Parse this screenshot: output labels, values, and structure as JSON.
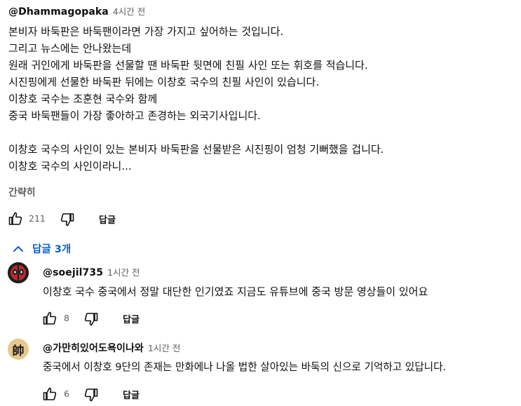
{
  "comment": {
    "author": "@Dhammagopaka",
    "time": "4시간 전",
    "lines": [
      "본비자 바둑판은 바둑팬이라면 가장 가지고 싶어하는 것입니다.",
      "그리고 뉴스에는 안나왔는데",
      "원래 귀인에게 바둑판을 선물할 땐 바둑판 뒷면에 친필 사인 또는 휘호를 적습니다.",
      "시진핑에게 선물한 바둑판 뒤에는 이창호 국수의 친필 사인이 있습니다.",
      "이창호 국수는 조훈현 국수와 함께",
      "중국 바둑팬들이 가장 좋아하고 존경하는 외국기사입니다.",
      "",
      "이창호 국수의 사인이 있는 본비자 바둑판을 선물받은 시진핑이 엄청  기뻐했을 겁니다.",
      "이창호 국수의 사인이라니..."
    ],
    "show_less": "간략히",
    "like_count": "211",
    "reply_label": "답글"
  },
  "replies_toggle": "답글 3개",
  "replies": [
    {
      "author": "@soejil735",
      "time": "1시간 전",
      "text": "이창호 국수 중국에서 정말 대단한 인기였죠 지금도 유튜브에 중국 방문 영상들이 있어요",
      "like_count": "8",
      "reply_label": "답글"
    },
    {
      "author": "@가만히있어도욕이나와",
      "time": "1시간 전",
      "text": "중국에서 이창호 9단의 존재는 만화에나 나올 법한 살아있는 바둑의 신으로 기억하고 있답니다.",
      "like_count": "6",
      "reply_label": "답글",
      "avatar_char": "帥"
    }
  ],
  "colors": {
    "link_blue": "#065fd4",
    "muted": "#606060",
    "avatar2_bg": "#e8c98a"
  },
  "icons": [
    "thumb-up-icon",
    "thumb-down-icon",
    "chevron-up-icon",
    "deadpool-avatar-icon"
  ]
}
